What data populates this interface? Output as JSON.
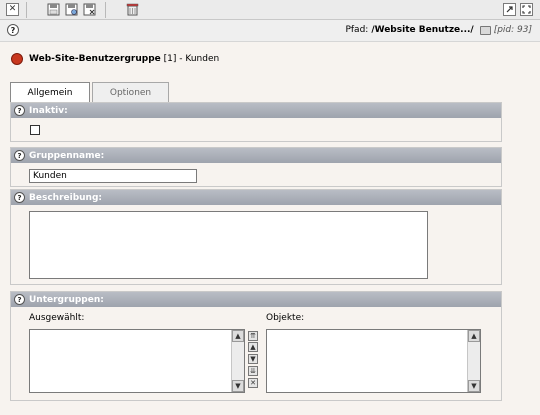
{
  "toolbar": {
    "close_icon": "close-icon",
    "save_icon": "save-icon",
    "save_view_icon": "save-view-icon",
    "save_close_icon": "save-close-icon",
    "delete_icon": "delete-icon",
    "open_window_icon": "open-new-window-icon",
    "fullscreen_icon": "fullscreen-icon",
    "close_glyph": "✕"
  },
  "pathbar": {
    "help_glyph": "?",
    "path_label": "Pfad:",
    "path_value": "/Website Benutze.../",
    "pid": "[pid: 93]"
  },
  "record": {
    "type": "Web-Site-Benutzergruppe",
    "uid": "[1]",
    "separator": "-",
    "title": "Kunden"
  },
  "tabs": [
    {
      "label": "Allgemein",
      "active": true
    },
    {
      "label": "Optionen",
      "active": false
    }
  ],
  "fields": {
    "inaktiv": {
      "label": "Inaktiv:",
      "checked": false
    },
    "gruppenname": {
      "label": "Gruppenname:",
      "value": "Kunden"
    },
    "beschreibung": {
      "label": "Beschreibung:",
      "value": ""
    },
    "untergruppen": {
      "label": "Untergruppen:",
      "selected_label": "Ausgewählt:",
      "objects_label": "Objekte:",
      "selected_items": [],
      "object_items": []
    }
  },
  "help_glyph": "?",
  "scroll_up_glyph": "▲",
  "scroll_down_glyph": "▼",
  "move_buttons": {
    "top": "⇈",
    "up": "▲",
    "down": "▼",
    "bottom": "⇊",
    "remove": "✕"
  },
  "colors": {
    "section_header": "#a8adb6",
    "background": "#f7f3ef",
    "usergroup_icon": "#c8371e"
  }
}
